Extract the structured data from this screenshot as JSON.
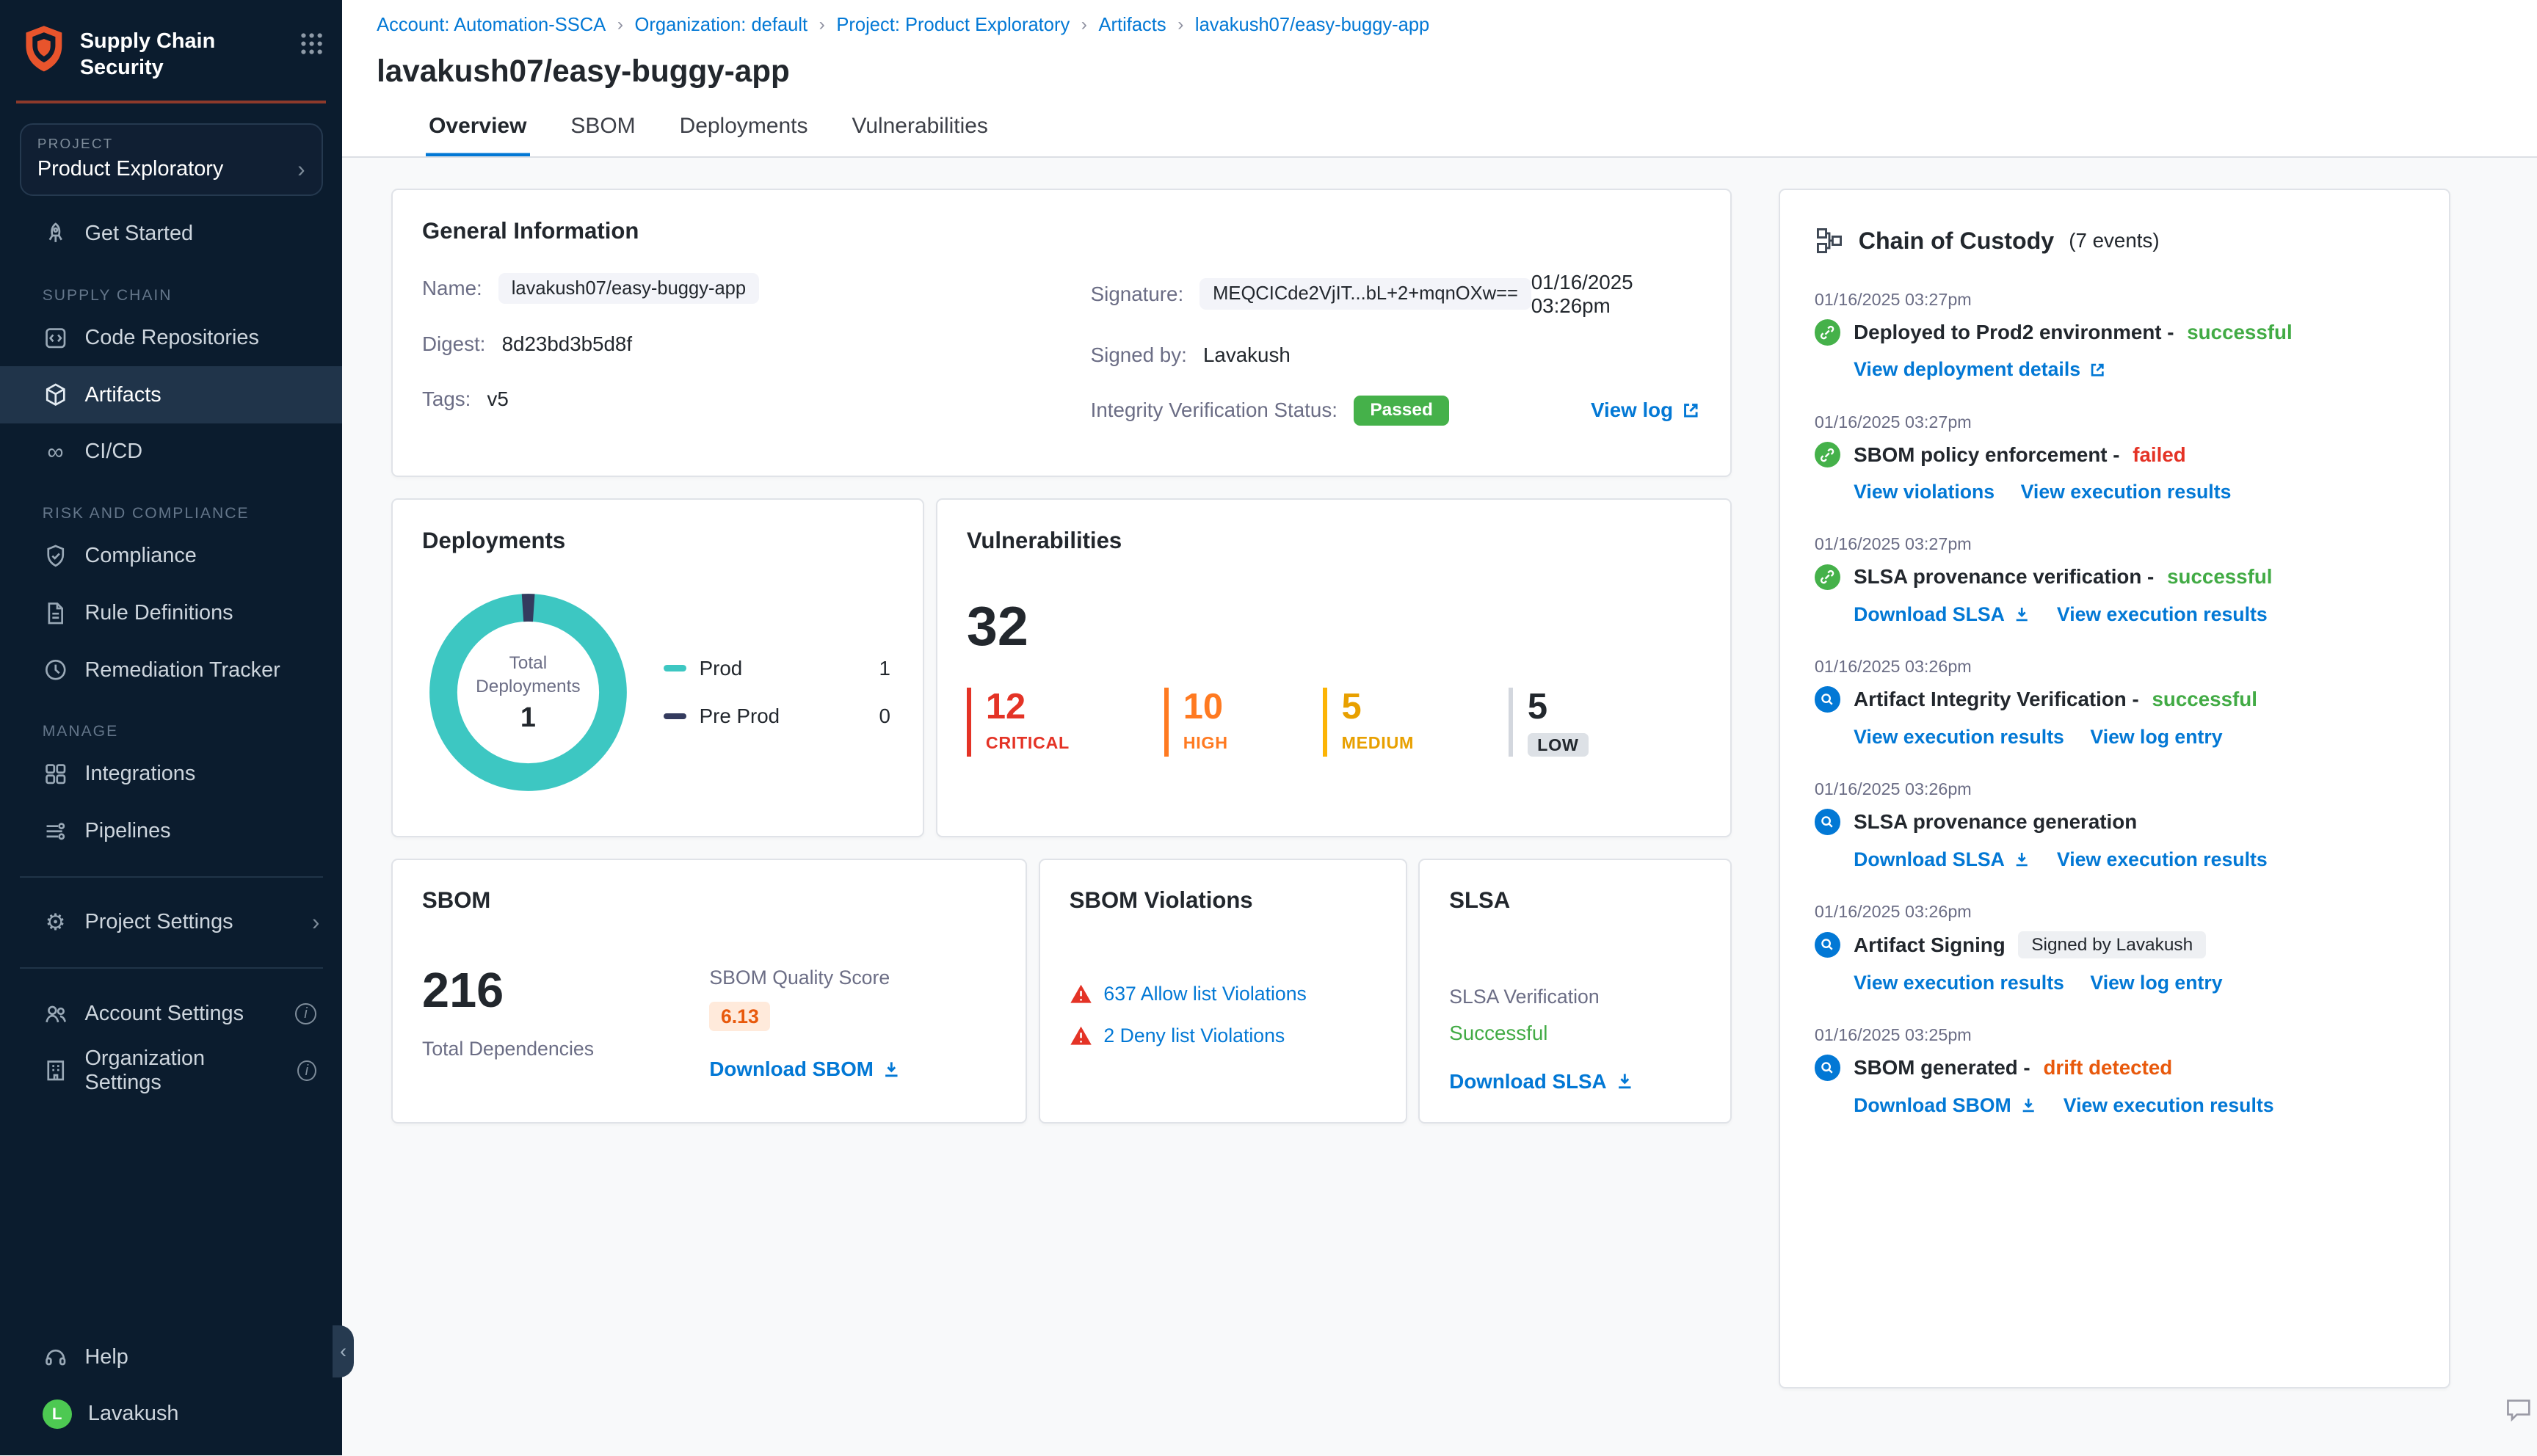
{
  "colors": {
    "sidebar_bg": "#0b1c2e",
    "accent_blue": "#0278d5",
    "success_green": "#42ab45",
    "error_red": "#e43326",
    "warning_orange": "#e8590c",
    "teal_prod": "#3dc7c2",
    "preprod_navy": "#343b5e",
    "critical": "#e43326",
    "high": "#ff7a21",
    "medium": "#fcb405",
    "passed_badge": "#45b14a"
  },
  "icons": {
    "breadcrumb_separator": "›",
    "chevron_right": "›",
    "sidebar_collapse": "‹",
    "cicd_infinity": "∞",
    "gear": "⚙",
    "info": "i"
  },
  "sidebar": {
    "app_title_line1": "Supply Chain",
    "app_title_line2": "Security",
    "project_label": "PROJECT",
    "project_value": "Product Exploratory",
    "nav": {
      "get_started": "Get Started",
      "section_supply_chain": "SUPPLY CHAIN",
      "code_repositories": "Code Repositories",
      "artifacts": "Artifacts",
      "cicd": "CI/CD",
      "section_risk": "RISK AND COMPLIANCE",
      "compliance": "Compliance",
      "rule_definitions": "Rule Definitions",
      "remediation_tracker": "Remediation Tracker",
      "section_manage": "MANAGE",
      "integrations": "Integrations",
      "pipelines": "Pipelines",
      "project_settings": "Project Settings",
      "account_settings": "Account Settings",
      "organization_settings": "Organization Settings",
      "help": "Help",
      "user_name": "Lavakush",
      "user_initial": "L"
    }
  },
  "header": {
    "breadcrumb": [
      "Account: Automation-SSCA",
      "Organization: default",
      "Project: Product Exploratory",
      "Artifacts",
      "lavakush07/easy-buggy-app"
    ],
    "title": "lavakush07/easy-buggy-app",
    "tabs": [
      {
        "label": "Overview"
      },
      {
        "label": "SBOM"
      },
      {
        "label": "Deployments"
      },
      {
        "label": "Vulnerabilities"
      }
    ]
  },
  "general_info": {
    "title": "General Information",
    "name_label": "Name:",
    "name_value": "lavakush07/easy-buggy-app",
    "digest_label": "Digest:",
    "digest_value": "8d23bd3b5d8f",
    "tags_label": "Tags:",
    "tags_value": "v5",
    "signature_label": "Signature:",
    "signature_value": "MEQCICde2VjIT...bL+2+mqnOXw==",
    "signature_time": "01/16/2025 03:26pm",
    "signed_by_label": "Signed by:",
    "signed_by_value": "Lavakush",
    "integrity_label": "Integrity Verification Status:",
    "integrity_status": "Passed",
    "view_log": "View log"
  },
  "deployments": {
    "title": "Deployments",
    "center_label_line1": "Total",
    "center_label_line2": "Deployments",
    "total": "1",
    "legend": [
      {
        "label": "Prod",
        "value": "1"
      },
      {
        "label": "Pre Prod",
        "value": "0"
      }
    ]
  },
  "vulnerabilities": {
    "title": "Vulnerabilities",
    "total": "32",
    "severities": [
      {
        "count": "12",
        "label": "CRITICAL"
      },
      {
        "count": "10",
        "label": "HIGH"
      },
      {
        "count": "5",
        "label": "MEDIUM"
      },
      {
        "count": "5",
        "label": "LOW"
      }
    ]
  },
  "sbom": {
    "title": "SBOM",
    "total": "216",
    "total_label": "Total Dependencies",
    "quality_label": "SBOM Quality Score",
    "quality_score": "6.13",
    "download_label": "Download SBOM"
  },
  "sbom_violations": {
    "title": "SBOM Violations",
    "items": [
      {
        "label": "637 Allow list Violations"
      },
      {
        "label": "2 Deny list Violations"
      }
    ]
  },
  "slsa": {
    "title": "SLSA",
    "verification_label": "SLSA Verification",
    "status": "Successful",
    "download_label": "Download SLSA"
  },
  "chain_of_custody": {
    "title": "Chain of Custody",
    "events_count": "(7 events)",
    "events": [
      {
        "time": "01/16/2025 03:27pm",
        "title": "Deployed to Prod2 environment -",
        "status": "successful",
        "links": [
          {
            "label": "View deployment details"
          }
        ]
      },
      {
        "time": "01/16/2025 03:27pm",
        "title": "SBOM policy enforcement -",
        "status": "failed",
        "links": [
          {
            "label": "View violations"
          },
          {
            "label": "View execution results"
          }
        ]
      },
      {
        "time": "01/16/2025 03:27pm",
        "title": "SLSA provenance verification -",
        "status": "successful",
        "links": [
          {
            "label": "Download SLSA"
          },
          {
            "label": "View execution results"
          }
        ]
      },
      {
        "time": "01/16/2025 03:26pm",
        "title": "Artifact Integrity Verification -",
        "status": "successful",
        "links": [
          {
            "label": "View execution results"
          },
          {
            "label": "View log entry"
          }
        ]
      },
      {
        "time": "01/16/2025 03:26pm",
        "title": "SLSA provenance generation",
        "links": [
          {
            "label": "Download SLSA"
          },
          {
            "label": "View execution results"
          }
        ]
      },
      {
        "time": "01/16/2025 03:26pm",
        "title": "Artifact Signing",
        "badge": "Signed by Lavakush",
        "links": [
          {
            "label": "View execution results"
          },
          {
            "label": "View log entry"
          }
        ]
      },
      {
        "time": "01/16/2025 03:25pm",
        "title": "SBOM generated -",
        "status": "drift detected",
        "links": [
          {
            "label": "Download SBOM"
          },
          {
            "label": "View execution results"
          }
        ]
      }
    ]
  }
}
